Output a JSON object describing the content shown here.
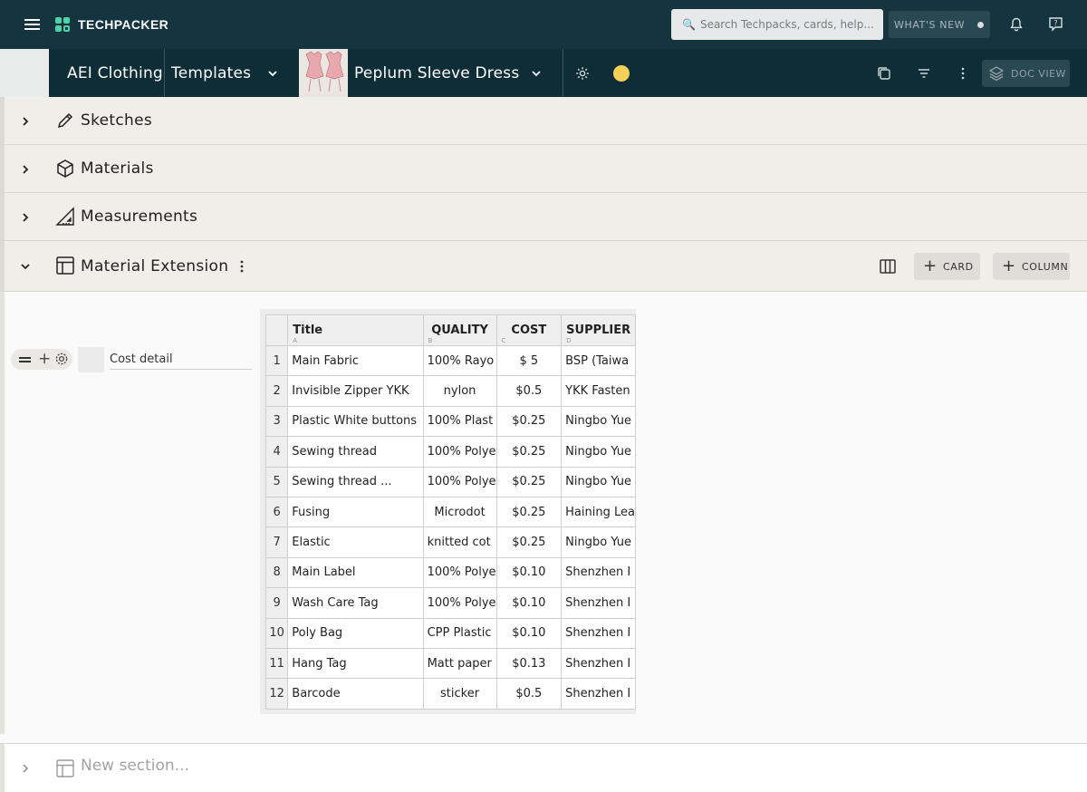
{
  "app": {
    "name": "TECHPACKER"
  },
  "search": {
    "placeholder": "Search Techpacks, cards, help..."
  },
  "topbar": {
    "whats_new_label": "WHAT'S NEW"
  },
  "breadcrumb": {
    "organization": "AEI Clothing",
    "folder": "Templates",
    "product": "Peplum Sleeve Dress"
  },
  "toolbar": {
    "doc_view_label": "DOC VIEW",
    "status_color": "#f5cf57"
  },
  "sections": [
    {
      "title": "Sketches",
      "icon": "pencil-icon",
      "expanded": false
    },
    {
      "title": "Materials",
      "icon": "box-icon",
      "expanded": false
    },
    {
      "title": "Measurements",
      "icon": "ruler-triangle-icon",
      "expanded": false
    },
    {
      "title": "Material Extension",
      "icon": "table-layout-icon",
      "expanded": true
    }
  ],
  "section_actions": {
    "card_label": "CARD",
    "column_label": "COLUMN"
  },
  "card": {
    "title": "Cost detail"
  },
  "table": {
    "columns": [
      {
        "label": "Title",
        "letter": "A"
      },
      {
        "label": "QUALITY",
        "letter": "B"
      },
      {
        "label": "COST",
        "letter": "C"
      },
      {
        "label": "SUPPLIER",
        "letter": "D"
      }
    ],
    "rows": [
      {
        "num": "1",
        "title": "Main Fabric",
        "quality": "100% Rayo",
        "cost": "$ 5",
        "supplier": "BSP (Taiwa"
      },
      {
        "num": "2",
        "title": "Invisible Zipper YKK",
        "quality": "nylon",
        "cost": "$0.5",
        "supplier": "YKK Fasten"
      },
      {
        "num": "3",
        "title": "Plastic White buttons",
        "quality": "100% Plast",
        "cost": "$0.25",
        "supplier": "Ningbo Yue"
      },
      {
        "num": "4",
        "title": "Sewing thread",
        "quality": "100% Polye",
        "cost": "$0.25",
        "supplier": "Ningbo Yue"
      },
      {
        "num": "5",
        "title": "Sewing thread ...",
        "quality": "100% Polye",
        "cost": "$0.25",
        "supplier": "Ningbo Yue"
      },
      {
        "num": "6",
        "title": "Fusing",
        "quality": "Microdot",
        "cost": "$0.25",
        "supplier": "Haining Lea"
      },
      {
        "num": "7",
        "title": "Elastic",
        "quality": "knitted cot",
        "cost": "$0.25",
        "supplier": "Ningbo Yue"
      },
      {
        "num": "8",
        "title": "Main Label",
        "quality": "100% Polye",
        "cost": "$0.10",
        "supplier": "Shenzhen I"
      },
      {
        "num": "9",
        "title": "Wash Care Tag",
        "quality": "100% Polye",
        "cost": "$0.10",
        "supplier": "Shenzhen I"
      },
      {
        "num": "10",
        "title": "Poly Bag",
        "quality": "CPP Plastic",
        "cost": "$0.10",
        "supplier": "Shenzhen I"
      },
      {
        "num": "11",
        "title": "Hang Tag",
        "quality": "Matt paper",
        "cost": "$0.13",
        "supplier": "Shenzhen I"
      },
      {
        "num": "12",
        "title": "Barcode",
        "quality": "sticker",
        "cost": "$0.5",
        "supplier": "Shenzhen I"
      }
    ]
  },
  "new_section": {
    "placeholder": "New section..."
  }
}
